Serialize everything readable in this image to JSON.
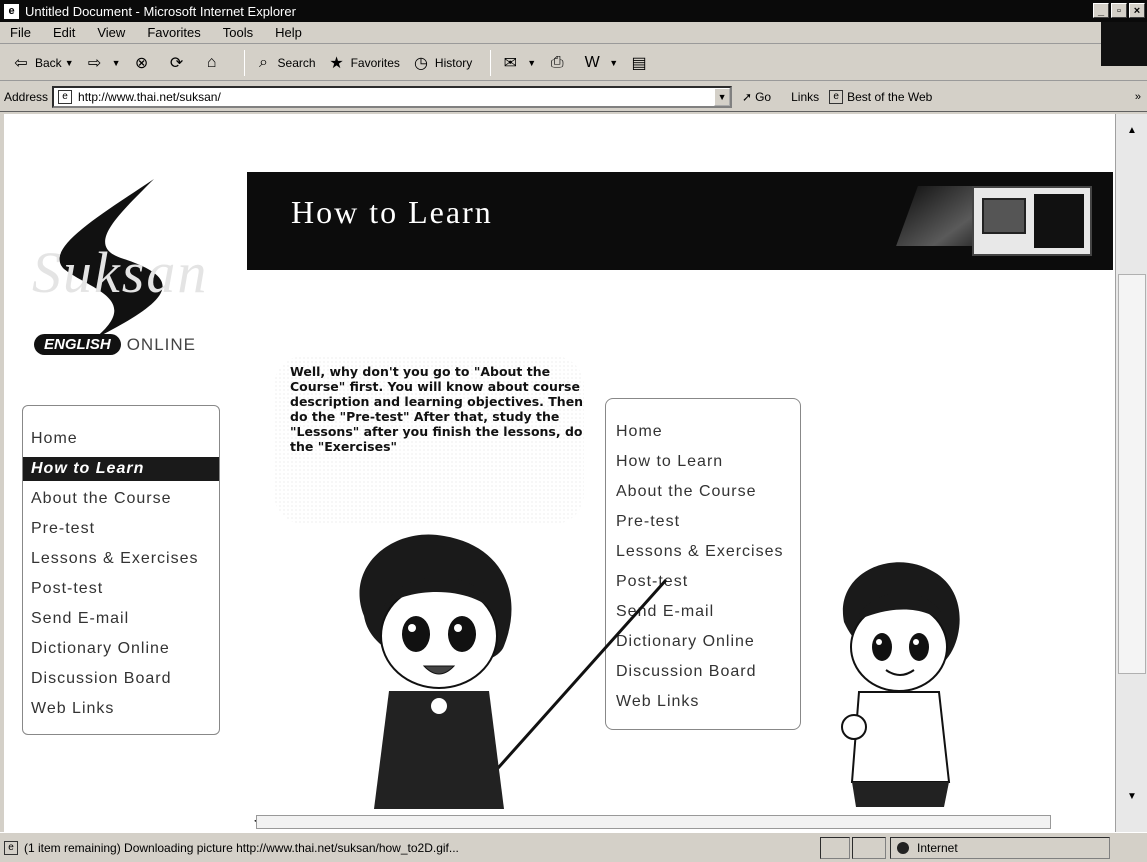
{
  "window": {
    "title": "Untitled Document - Microsoft Internet Explorer",
    "controls": [
      "_",
      "▫",
      "×"
    ]
  },
  "menu": [
    "File",
    "Edit",
    "View",
    "Favorites",
    "Tools",
    "Help"
  ],
  "toolbar": {
    "back_label": "Back",
    "search_label": "Search",
    "favorites_label": "Favorites",
    "history_label": "History"
  },
  "address": {
    "label": "Address",
    "url": "http://www.thai.net/suksan/",
    "go_label": "Go",
    "links_label": "Links",
    "best_of_web": "Best of the Web",
    "chevron": "»"
  },
  "logo": {
    "word": "Suksan",
    "english": "ENGLISH",
    "online": "ONLINE"
  },
  "banner": {
    "title": "How to Learn"
  },
  "left_nav": [
    {
      "label": "Home",
      "active": false
    },
    {
      "label": "How to Learn",
      "active": true
    },
    {
      "label": "About the Course",
      "active": false
    },
    {
      "label": "Pre-test",
      "active": false
    },
    {
      "label": "Lessons & Exercises",
      "active": false
    },
    {
      "label": "Post-test",
      "active": false
    },
    {
      "label": "Send E-mail",
      "active": false
    },
    {
      "label": "Dictionary Online",
      "active": false
    },
    {
      "label": "Discussion Board",
      "active": false
    },
    {
      "label": "Web Links",
      "active": false
    }
  ],
  "bubble": {
    "text": "Well, why don't you go to \"About the Course\" first. You will know about course description and learning objectives. Then do the \"Pre-test\" After that, study the \"Lessons\" after you finish the lessons, do the \"Exercises\""
  },
  "right_nav": [
    "Home",
    "How to Learn",
    "About the Course",
    "Pre-test",
    "Lessons & Exercises",
    "Post-test",
    "Send E-mail",
    "Dictionary Online",
    "Discussion Board",
    "Web Links"
  ],
  "status": {
    "text": "(1 item remaining) Downloading picture http://www.thai.net/suksan/how_to2D.gif...",
    "zone": "Internet"
  }
}
